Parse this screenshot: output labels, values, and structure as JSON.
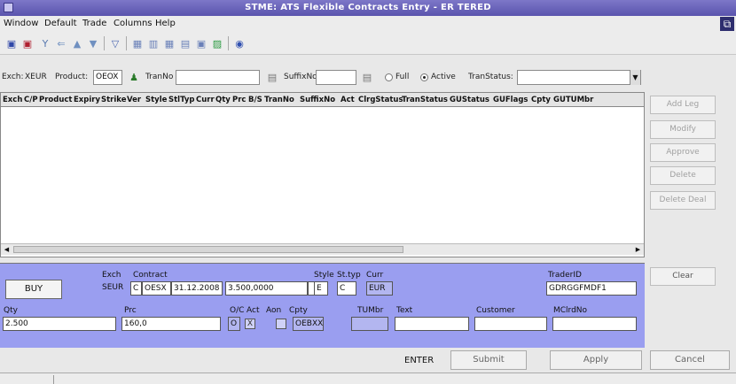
{
  "window": {
    "title": "STME: ATS Flexible Contracts Entry - ER TERED"
  },
  "menu": [
    "Window",
    "Default",
    "Trade",
    "Columns",
    "Help"
  ],
  "filter": {
    "exch_label": "Exch:",
    "exch_value": "XEUR",
    "product_label": "Product:",
    "product_value": "OEOX",
    "tranno_label": "TranNo",
    "suffix_label": "SuffixNo:",
    "full_label": "Full",
    "active_label": "Active",
    "transtatus_label": "TranStatus:"
  },
  "grid": {
    "columns": [
      "Exch",
      "C/P",
      "Product",
      "Expiry",
      "Strike",
      "Ver",
      "Style",
      "StlTyp",
      "Curr",
      "Qty",
      "Prc",
      "B/S",
      "TranNo",
      "SuffixNo",
      "Act",
      "ClrgStatus",
      "TranStatus",
      "GUStatus",
      "GUFlags",
      "Cpty",
      "GUTUMbr"
    ]
  },
  "side_buttons": [
    "Add Leg",
    "Modify",
    "Approve",
    "Delete",
    "Delete Deal"
  ],
  "entry": {
    "buy_label": "BUY",
    "exch_label": "Exch",
    "exch_value": "SEUR",
    "contract_label": "Contract",
    "cp_value": "C",
    "product_value": "OESX",
    "expiry_value": "31.12.2008",
    "strike_value": "3.500,0000",
    "ver_value": "",
    "style_label": "Style",
    "style_value": "E",
    "stltyp_label": "St.typ",
    "stltyp_value": "C",
    "curr_label": "Curr",
    "curr_value": "EUR",
    "traderid_label": "TraderID",
    "traderid_value": "GDRGGFMDF1",
    "clear_label": "Clear",
    "qty_label": "Qty",
    "qty_value": "2.500",
    "prc_label": "Prc",
    "prc_value": "160,0",
    "oc_label": "O/C",
    "oc_value": "O",
    "act_label": "Act",
    "act_value": "X",
    "aon_label": "Aon",
    "cpty_label": "Cpty",
    "cpty_value": "OEBXX",
    "tumbr_label": "TUMbr",
    "text_label": "Text",
    "customer_label": "Customer",
    "mclrdno_label": "MClrdNo"
  },
  "bottom": {
    "enter_label": "ENTER",
    "submit_label": "Submit",
    "apply_label": "Apply",
    "cancel_label": "Cancel"
  }
}
